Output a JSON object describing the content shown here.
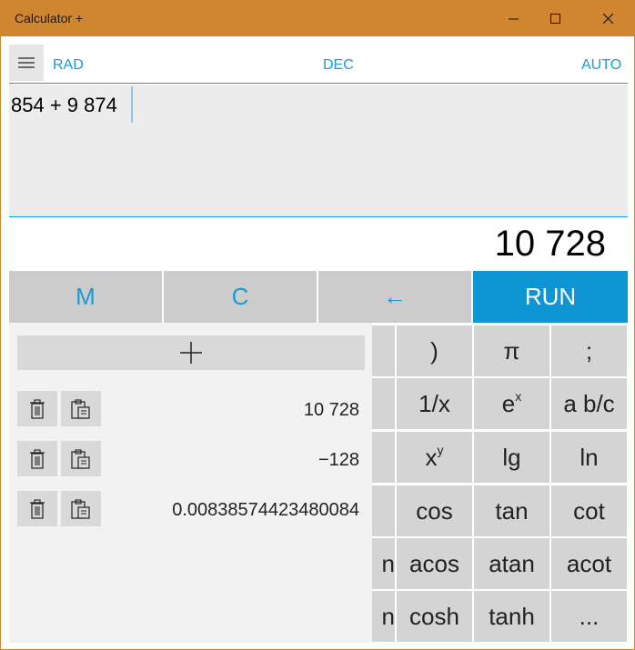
{
  "window": {
    "title": "Calculator +"
  },
  "toolbar": {
    "angle_mode": "RAD",
    "number_base": "DEC",
    "format_mode": "AUTO"
  },
  "expression": {
    "value": "854 + 9 874"
  },
  "result": {
    "value": "10 728"
  },
  "top_buttons": {
    "memory": "M",
    "clear": "C",
    "backspace": "←",
    "run": "RUN"
  },
  "keys": {
    "row1": [
      ")",
      "π",
      ";"
    ],
    "row2": [
      "1/x",
      "e",
      "a b/c"
    ],
    "row2_sup": "x",
    "row3": [
      "x",
      "lg",
      "ln"
    ],
    "row3_sup": "y",
    "row4": [
      "cos",
      "tan",
      "cot"
    ],
    "row5": [
      "n",
      "acos",
      "atan",
      "acot"
    ],
    "row6": [
      "n",
      "cosh",
      "tanh",
      "..."
    ]
  },
  "memory": {
    "add_icon": "plus-icon",
    "items": [
      "10 728",
      "−128",
      "0.00838574423480084"
    ]
  },
  "colors": {
    "title_bar": "#cf862e",
    "accent": "#1a9ad6",
    "run_button": "#0e95d4"
  }
}
